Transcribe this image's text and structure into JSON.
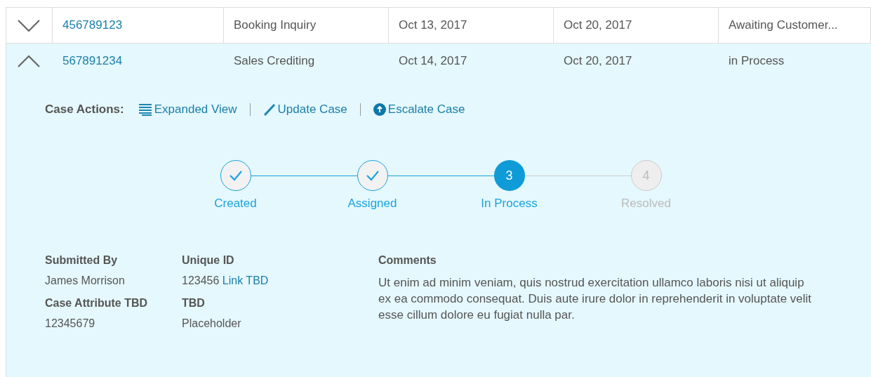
{
  "table": {
    "rows": [
      {
        "expanded": false,
        "cells": [
          "456789123",
          "Booking Inquiry",
          "Oct 13, 2017",
          "Oct 20, 2017",
          "Awaiting Customer..."
        ]
      },
      {
        "expanded": true,
        "cells": [
          "567891234",
          "Sales Crediting",
          "Oct 14, 2017",
          "Oct 20, 2017",
          "in Process"
        ],
        "details": {
          "actions_label": "Case Actions:",
          "actions": [
            {
              "kind": "list",
              "label": "Expanded View"
            },
            {
              "kind": "pencil",
              "label": "Update Case"
            },
            {
              "kind": "escalate",
              "label": "Escalate Case"
            }
          ],
          "steps": [
            {
              "kind": "done",
              "label": "Created"
            },
            {
              "kind": "done",
              "label": "Assigned"
            },
            {
              "kind": "current",
              "number": "3",
              "label": "In Process"
            },
            {
              "kind": "pending",
              "number": "4",
              "label": "Resolved"
            }
          ],
          "fields": [
            {
              "label": "Submitted By",
              "value": "James Morrison"
            },
            {
              "label": "Unique ID",
              "value": "123456",
              "link": "Link TBD"
            },
            {
              "label": "Case Attribute TBD",
              "value": "12345679"
            },
            {
              "label": "TBD",
              "value": "Placeholder"
            }
          ],
          "comments": {
            "label": "Comments",
            "text": "Ut enim ad minim veniam, quis nostrud exercitation ullamco laboris nisi ut aliquip ex ea commodo consequat. Duis aute irure dolor in reprehenderit in voluptate velit esse cillum dolore eu fugiat nulla par."
          }
        }
      }
    ]
  }
}
